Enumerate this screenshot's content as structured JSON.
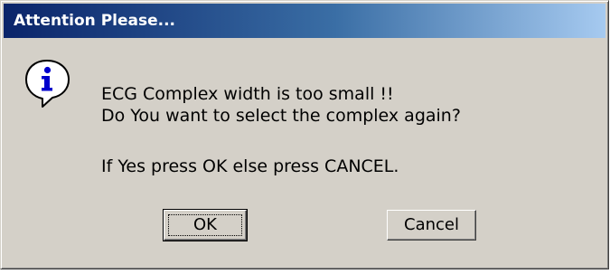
{
  "window": {
    "title": "Attention Please..."
  },
  "icon": {
    "name": "information-icon",
    "glyph": "i",
    "colors": {
      "body": "#ffffff",
      "outline": "#000000",
      "glyph": "#0000cc"
    }
  },
  "message": {
    "line1": "ECG Complex width is too small !!",
    "line2": "Do You want to select the complex again?",
    "line3": "If Yes press OK else press CANCEL."
  },
  "buttons": {
    "ok_label": "OK",
    "cancel_label": "Cancel"
  },
  "colors": {
    "dialog_face": "#d4d0c8",
    "titlebar_start": "#0a246a",
    "titlebar_end": "#a6caf0",
    "title_text": "#ffffff"
  }
}
